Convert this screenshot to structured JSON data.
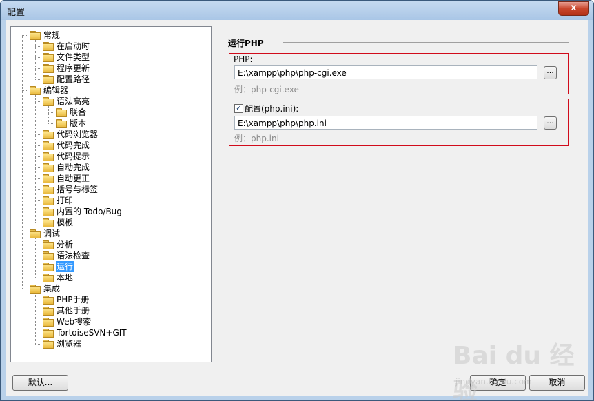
{
  "window": {
    "title": "配置",
    "close_glyph": "x"
  },
  "tree": [
    {
      "label": "常规",
      "level": 0
    },
    {
      "label": "在启动时",
      "level": 1
    },
    {
      "label": "文件类型",
      "level": 1
    },
    {
      "label": "程序更新",
      "level": 1
    },
    {
      "label": "配置路径",
      "level": 1
    },
    {
      "label": "编辑器",
      "level": 0
    },
    {
      "label": "语法高亮",
      "level": 1
    },
    {
      "label": "联合",
      "level": 2
    },
    {
      "label": "版本",
      "level": 2
    },
    {
      "label": "代码浏览器",
      "level": 1
    },
    {
      "label": "代码完成",
      "level": 1
    },
    {
      "label": "代码提示",
      "level": 1
    },
    {
      "label": "自动完成",
      "level": 1
    },
    {
      "label": "自动更正",
      "level": 1
    },
    {
      "label": "括号与标签",
      "level": 1
    },
    {
      "label": "打印",
      "level": 1
    },
    {
      "label": "内置的 Todo/Bug",
      "level": 1
    },
    {
      "label": "模板",
      "level": 1
    },
    {
      "label": "调试",
      "level": 0
    },
    {
      "label": "分析",
      "level": 1
    },
    {
      "label": "语法检查",
      "level": 1
    },
    {
      "label": "运行",
      "level": 1,
      "selected": true
    },
    {
      "label": "本地",
      "level": 1
    },
    {
      "label": "集成",
      "level": 0
    },
    {
      "label": "PHP手册",
      "level": 1
    },
    {
      "label": "其他手册",
      "level": 1
    },
    {
      "label": "Web搜索",
      "level": 1
    },
    {
      "label": "TortoiseSVN+GIT",
      "level": 1
    },
    {
      "label": "浏览器",
      "level": 1
    }
  ],
  "panel": {
    "title": "运行PHP",
    "php": {
      "label": "PHP:",
      "value": "E:\\xampp\\php\\php-cgi.exe",
      "hint": "例：php-cgi.exe",
      "browse": "..."
    },
    "ini": {
      "label": "配置(php.ini):",
      "checked": true,
      "value": "E:\\xampp\\php\\php.ini",
      "hint": "例：php.ini",
      "browse": "...",
      "check_glyph": "✓"
    }
  },
  "buttons": {
    "default": "默认...",
    "ok": "确定",
    "cancel": "取消"
  },
  "watermark": {
    "main": "Bai du 经验",
    "sub": "jingyan.baidu.com"
  },
  "colors": {
    "highlight": "#3399ff",
    "group_border": "#d10b1b",
    "folder": "#f2c94c"
  }
}
